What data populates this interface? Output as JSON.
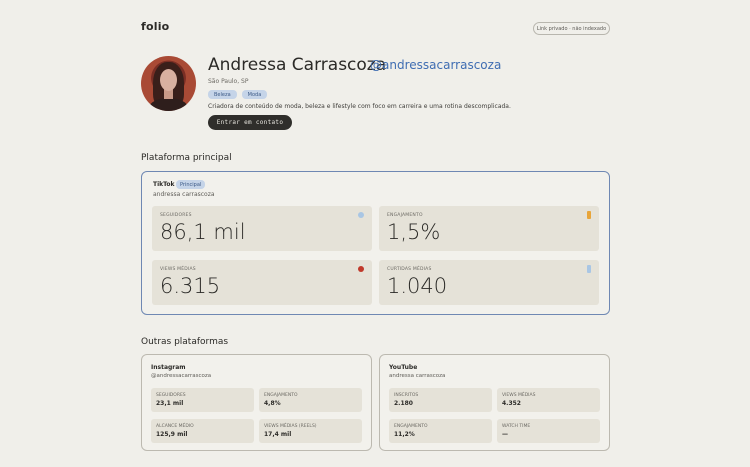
{
  "header": {
    "logo": "folio",
    "privacy": "Link privado · não indexado"
  },
  "profile": {
    "name": "Andressa Carrascoza",
    "handle": "@andressacarrascoza",
    "location": "São Paulo, SP",
    "tags": [
      "Beleza",
      "Moda"
    ],
    "bio": "Criadora de conteúdo de moda, beleza e lifestyle com foco em carreira e uma rotina descomplicada.",
    "contact_label": "Entrar em contato"
  },
  "main_section": {
    "title": "Plataforma principal",
    "platform": "TikTok",
    "badge": "Principal",
    "handle": "andressa carrascoza",
    "stats": [
      {
        "label": "SEGUIDORES",
        "value": "86,1 mil",
        "color": "#a9c6e4"
      },
      {
        "label": "ENGAJAMENTO",
        "value": "1,5%",
        "color": "#e8a53a"
      },
      {
        "label": "VIEWS MÉDIAS",
        "value": "6.315",
        "color": "#c0392b"
      },
      {
        "label": "CURTIDAS MÉDIAS",
        "value": "1.040",
        "color": "#a9c6e4"
      }
    ]
  },
  "other_section": {
    "title": "Outras plataformas",
    "instagram": {
      "name": "Instagram",
      "handle": "@andressacarrascoza",
      "stats": [
        {
          "label": "SEGUIDORES",
          "value": "23,1 mil"
        },
        {
          "label": "ENGAJAMENTO",
          "value": "4,8%"
        },
        {
          "label": "ALCANCE MÉDIO",
          "value": "125,9 mil"
        },
        {
          "label": "VIEWS MÉDIAS (REELS)",
          "value": "17,4 mil"
        }
      ]
    },
    "youtube": {
      "name": "YouTube",
      "handle": "andressa carrascoza",
      "stats": [
        {
          "label": "INSCRITOS",
          "value": "2.180"
        },
        {
          "label": "VIEWS MÉDIAS",
          "value": "4.352"
        },
        {
          "label": "ENGAJAMENTO",
          "value": "11,2%"
        },
        {
          "label": "WATCH TIME",
          "value": "—"
        }
      ]
    }
  }
}
